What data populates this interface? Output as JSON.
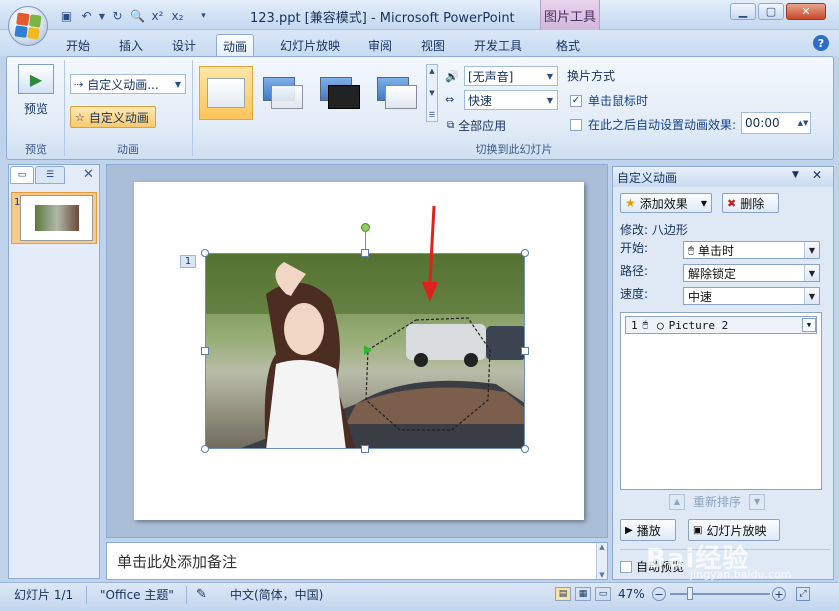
{
  "window": {
    "doc_title": "123.ppt [兼容模式] - Microsoft PowerPoint",
    "contextual_tab": "图片工具"
  },
  "tabs": [
    "开始",
    "插入",
    "设计",
    "动画",
    "幻灯片放映",
    "审阅",
    "视图",
    "开发工具",
    "格式"
  ],
  "active_tab": "动画",
  "ribbon": {
    "preview": {
      "button": "预览",
      "group": "预览"
    },
    "animation": {
      "custom_combo": "自定义动画...",
      "custom_button": "自定义动画",
      "group": "动画"
    },
    "transition": {
      "sound": "[无声音]",
      "speed": "快速",
      "apply_all": "全部应用",
      "group": "切换到此幻灯片"
    },
    "advance": {
      "title": "换片方式",
      "on_click": "单击鼠标时",
      "on_click_checked": true,
      "auto_label": "在此之后自动设置动画效果:",
      "auto_checked": false,
      "auto_time": "00:00"
    }
  },
  "slides_pane": {
    "slide_number": "1"
  },
  "slide": {
    "anim_tag": "1"
  },
  "notes_placeholder": "单击此处添加备注",
  "task_pane": {
    "title": "自定义动画",
    "add_effect": "添加效果",
    "delete": "删除",
    "modify_label": "修改: 八边形",
    "start_label": "开始:",
    "start_value": "单击时",
    "path_label": "路径:",
    "path_value": "解除锁定",
    "speed_label": "速度:",
    "speed_value": "中速",
    "list_item": {
      "index": "1",
      "name": "Picture 2"
    },
    "reorder": "重新排序",
    "play": "播放",
    "slideshow": "幻灯片放映",
    "autopreview": "自动预览",
    "autopreview_checked": false
  },
  "status": {
    "slide_info": "幻灯片 1/1",
    "theme": "\"Office 主题\"",
    "language": "中文(简体，中国)",
    "zoom": "47%"
  },
  "watermark": {
    "text": "Bai经验",
    "url": "jingyan.baidu.com"
  },
  "colors": {
    "accent_orange": "#f8c987",
    "ribbon_blue": "#dfe9f6",
    "arrow_red": "#e0201a",
    "path_green": "#2eb82e"
  }
}
